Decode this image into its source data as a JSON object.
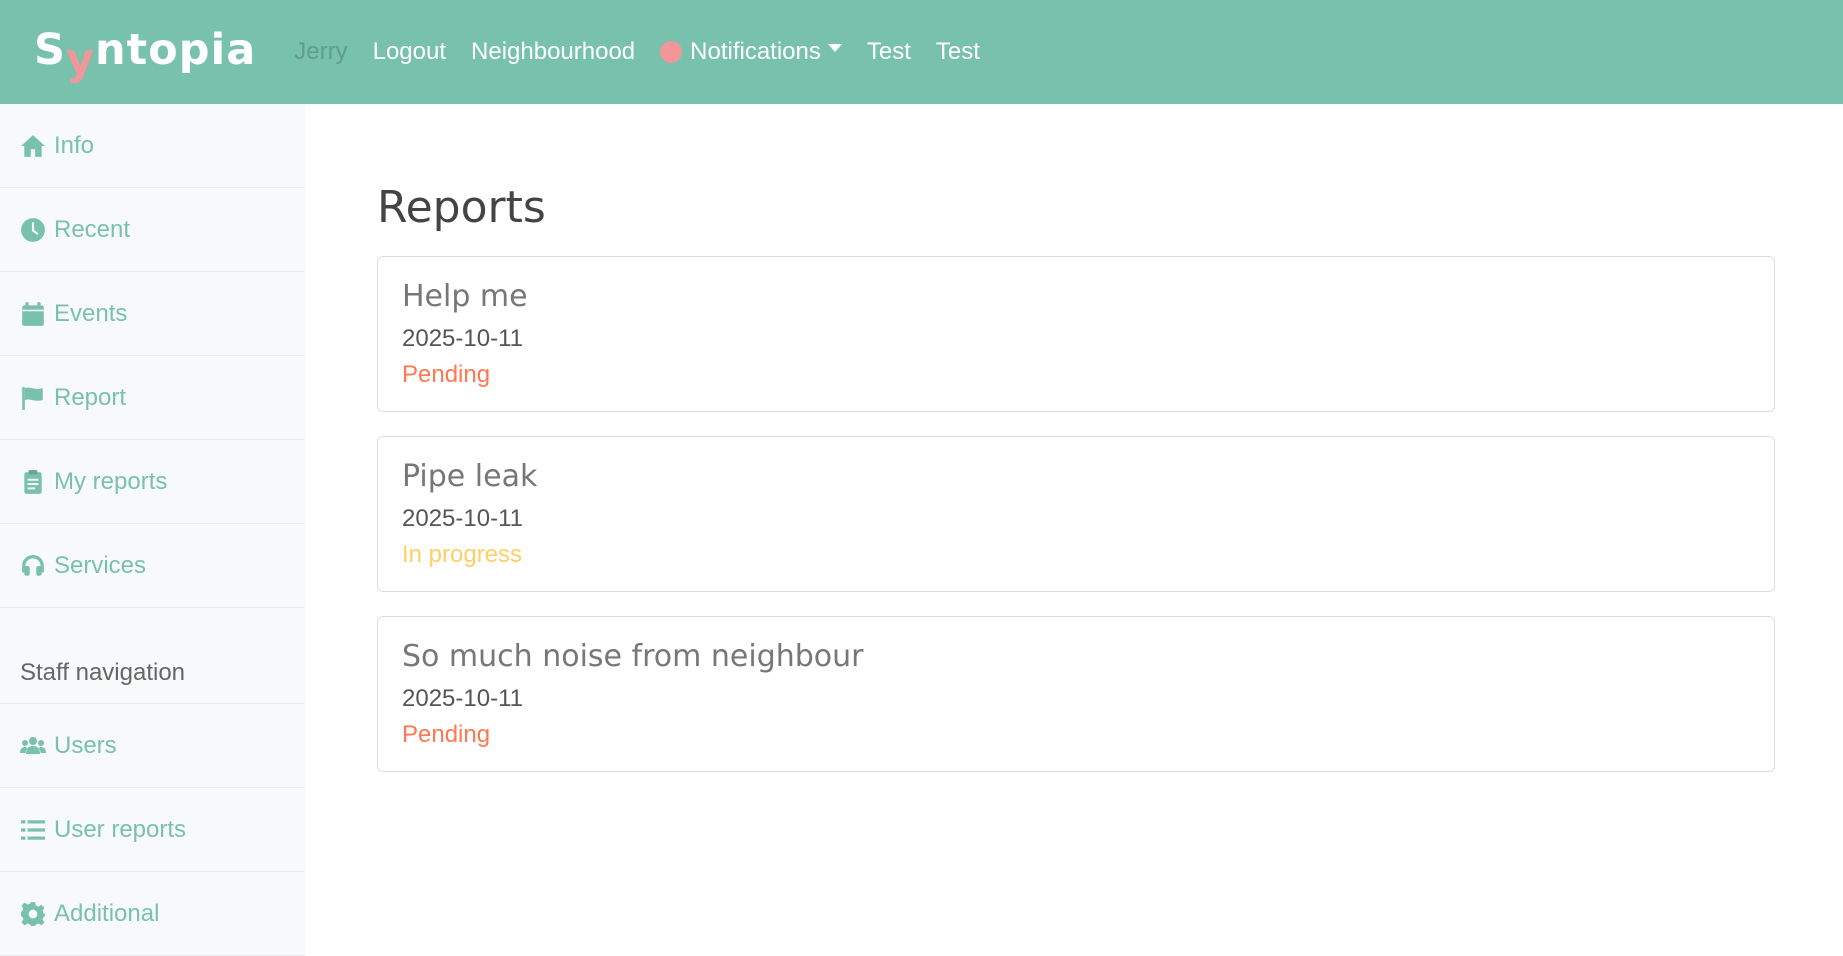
{
  "brand": {
    "pre": "S",
    "y": "y",
    "post": "ntopia"
  },
  "nav": {
    "user": "Jerry",
    "logout": "Logout",
    "neighbourhood": "Neighbourhood",
    "notifications": "Notifications",
    "test1": "Test",
    "test2": "Test"
  },
  "sidebar": {
    "items": [
      {
        "label": "Info",
        "icon": "home-icon"
      },
      {
        "label": "Recent",
        "icon": "clock-icon"
      },
      {
        "label": "Events",
        "icon": "calendar-icon"
      },
      {
        "label": "Report",
        "icon": "flag-icon"
      },
      {
        "label": "My reports",
        "icon": "clipboard-icon"
      },
      {
        "label": "Services",
        "icon": "headset-icon"
      }
    ],
    "staff_header": "Staff navigation",
    "staff_items": [
      {
        "label": "Users",
        "icon": "users-icon"
      },
      {
        "label": "User reports",
        "icon": "list-icon"
      },
      {
        "label": "Additional",
        "icon": "gear-icon"
      }
    ]
  },
  "main": {
    "title": "Reports",
    "reports": [
      {
        "title": "Help me",
        "date": "2025-10-11",
        "status": "Pending",
        "status_color": "#ff7851"
      },
      {
        "title": "Pipe leak",
        "date": "2025-10-11",
        "status": "In progress",
        "status_color": "#ffce67"
      },
      {
        "title": "So much noise from neighbour",
        "date": "2025-10-11",
        "status": "Pending",
        "status_color": "#ff7851"
      }
    ]
  },
  "colors": {
    "primary": "#78c2ad",
    "secondary": "#f3969a",
    "pending": "#ff7851",
    "in_progress": "#ffce67"
  }
}
